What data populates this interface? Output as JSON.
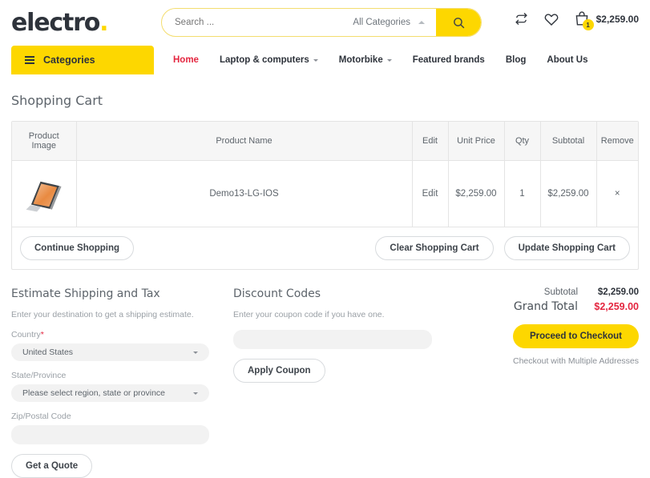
{
  "header": {
    "logo_text": "electro",
    "logo_dot": ".",
    "search": {
      "placeholder": "Search ...",
      "value": "",
      "category_label": "All Categories",
      "search_icon": "search-icon"
    },
    "icons": {
      "compare": "compare-icon",
      "wishlist": "heart-icon",
      "cart": "shopping-bag-icon"
    },
    "cart_count": "1",
    "cart_total": "$2,259.00"
  },
  "nav": {
    "categories_label": "Categories",
    "links": [
      {
        "label": "Home",
        "active": true,
        "has_caret": false
      },
      {
        "label": "Laptop & computers",
        "active": false,
        "has_caret": true
      },
      {
        "label": "Motorbike",
        "active": false,
        "has_caret": true
      },
      {
        "label": "Featured brands",
        "active": false,
        "has_caret": false
      },
      {
        "label": "Blog",
        "active": false,
        "has_caret": false
      },
      {
        "label": "About Us",
        "active": false,
        "has_caret": false
      }
    ]
  },
  "page": {
    "title": "Shopping Cart"
  },
  "cart_table": {
    "columns": [
      "Product Image",
      "Product Name",
      "Edit",
      "Unit Price",
      "Qty",
      "Subtotal",
      "Remove"
    ],
    "rows": [
      {
        "image_alt": "laptop-thumbnail",
        "product_name": "Demo13-LG-IOS",
        "edit_label": "Edit",
        "unit_price": "$2,259.00",
        "qty": "1",
        "subtotal": "$2,259.00",
        "remove_label": "×"
      }
    ]
  },
  "cart_actions": {
    "continue_shopping": "Continue Shopping",
    "clear_cart": "Clear Shopping Cart",
    "update_cart": "Update Shopping Cart"
  },
  "shipping": {
    "title": "Estimate Shipping and Tax",
    "note": "Enter your destination to get a shipping estimate.",
    "country_label": "Country",
    "country_required": "*",
    "country_value": "United States",
    "state_label": "State/Province",
    "state_value": "Please select region, state or province",
    "zip_label": "Zip/Postal Code",
    "zip_value": "",
    "zip_placeholder": "",
    "quote_button": "Get a Quote"
  },
  "discount": {
    "title": "Discount Codes",
    "note": "Enter your coupon code if you have one.",
    "coupon_value": "",
    "coupon_placeholder": "",
    "apply_button": "Apply Coupon"
  },
  "totals": {
    "subtotal_label": "Subtotal",
    "subtotal_value": "$2,259.00",
    "grand_total_label": "Grand Total",
    "grand_total_value": "$2,259.00",
    "checkout_button": "Proceed to Checkout",
    "multiple_addresses": "Checkout with Multiple Addresses"
  },
  "colors": {
    "brand_yellow": "#fdd700",
    "accent_red": "#e4253f",
    "text_dark": "#2e333b",
    "text_muted": "#9aa0a6"
  }
}
